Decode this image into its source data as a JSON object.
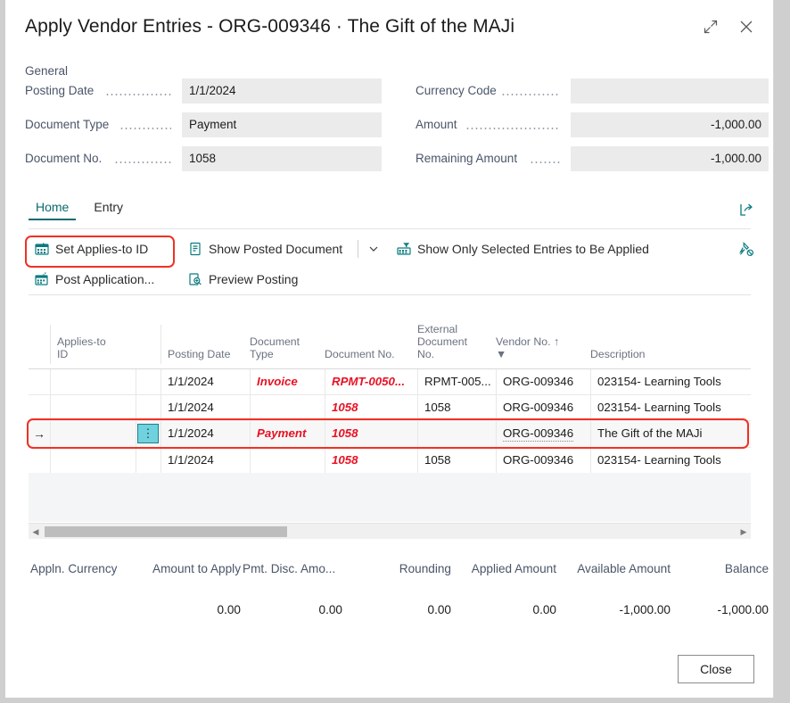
{
  "window": {
    "title": "Apply Vendor Entries - ORG-009346 · The Gift of the MAJi",
    "expand_icon": "expand-diagonal-icon",
    "close_icon": "close-icon"
  },
  "general": {
    "section_label": "General",
    "left_fields": [
      {
        "label": "Posting Date",
        "value": "1/1/2024"
      },
      {
        "label": "Document Type",
        "value": "Payment"
      },
      {
        "label": "Document No.",
        "value": "1058"
      }
    ],
    "right_fields": [
      {
        "label": "Currency Code",
        "value": ""
      },
      {
        "label": "Amount",
        "value": "-1,000.00"
      },
      {
        "label": "Remaining Amount",
        "value": "-1,000.00"
      }
    ]
  },
  "ribbon": {
    "tabs": [
      {
        "label": "Home",
        "active": true
      },
      {
        "label": "Entry",
        "active": false
      }
    ],
    "share_icon": "share-icon",
    "unpin_icon": "unpin-icon",
    "commands_row1": [
      {
        "label": "Set Applies-to ID",
        "icon": "calendar-applies-icon"
      },
      {
        "label": "Show Posted Document",
        "icon": "document-icon"
      },
      {
        "label": "Show Only Selected Entries to Be Applied",
        "icon": "filter-entries-icon"
      }
    ],
    "commands_row2": [
      {
        "label": "Post Application...",
        "icon": "post-application-icon"
      },
      {
        "label": "Preview Posting",
        "icon": "preview-posting-icon"
      }
    ],
    "dropdown_icon": "chevron-down-icon"
  },
  "grid": {
    "columns": [
      {
        "label": "Applies-to\nID",
        "name": "applies-to-id"
      },
      {
        "label": "Posting Date",
        "name": "posting-date"
      },
      {
        "label": "Document\nType",
        "name": "document-type"
      },
      {
        "label": "Document No.",
        "name": "document-no"
      },
      {
        "label": "External\nDocument\nNo.",
        "name": "external-document-no"
      },
      {
        "label": "Vendor No. ↑",
        "name": "vendor-no"
      },
      {
        "label": "Description",
        "name": "description"
      }
    ],
    "vendor_filter_icon": "filter-icon",
    "rows": [
      {
        "applies_to_id": "",
        "posting_date": "1/1/2024",
        "document_type": "Invoice",
        "document_no": "RPMT-0050...",
        "external_document_no": "RPMT-005...",
        "vendor_no": "ORG-009346",
        "description": "023154- Learning Tools",
        "selected": false,
        "red": true
      },
      {
        "applies_to_id": "",
        "posting_date": "1/1/2024",
        "document_type": "",
        "document_no": "1058",
        "external_document_no": "1058",
        "vendor_no": "ORG-009346",
        "description": "023154- Learning Tools",
        "selected": false,
        "red": true
      },
      {
        "applies_to_id": "",
        "posting_date": "1/1/2024",
        "document_type": "Payment",
        "document_no": "1058",
        "external_document_no": "",
        "vendor_no": "ORG-009346",
        "description": "The Gift of the MAJi",
        "selected": true,
        "red": true
      },
      {
        "applies_to_id": "",
        "posting_date": "1/1/2024",
        "document_type": "",
        "document_no": "1058",
        "external_document_no": "1058",
        "vendor_no": "ORG-009346",
        "description": "023154- Learning Tools",
        "selected": false,
        "red": true
      }
    ],
    "row_menu_icon": "row-menu-dots-icon",
    "row_indicator_icon": "row-arrow-icon",
    "scroll_left_icon": "scroll-left-arrow",
    "scroll_right_icon": "scroll-right-arrow"
  },
  "totals": {
    "headers": [
      "Appln. Currency",
      "Amount to Apply",
      "Pmt. Disc. Amo...",
      "Rounding",
      "Applied Amount",
      "Available Amount",
      "Balance"
    ],
    "values": [
      "",
      "0.00",
      "0.00",
      "0.00",
      "0.00",
      "-1,000.00",
      "-1,000.00"
    ]
  },
  "footer": {
    "close_label": "Close"
  },
  "colors": {
    "accent": "#0b7b80",
    "tab_active": "#0b6a6e",
    "grid_red": "#e81123",
    "highlight_box": "#ef3124",
    "cell_selected": "#6fd2de",
    "field_bg": "#ebebeb"
  }
}
